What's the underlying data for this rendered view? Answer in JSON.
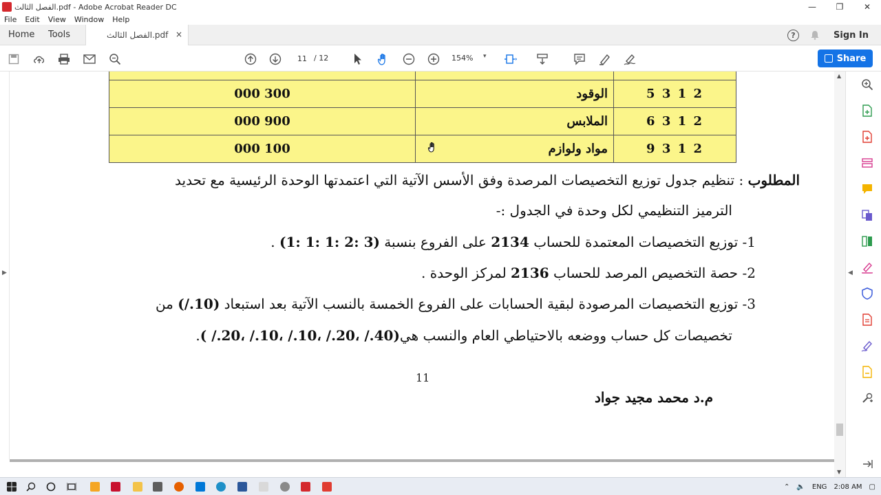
{
  "window": {
    "title": "الفصل الثالث.pdf - Adobe Acrobat Reader DC",
    "minimize": "—",
    "maximize": "❐",
    "close": "✕"
  },
  "menu": [
    "File",
    "Edit",
    "View",
    "Window",
    "Help"
  ],
  "tabs": {
    "home": "Home",
    "tools": "Tools",
    "document": "الفصل الثالث.pdf",
    "close": "×"
  },
  "header_right": {
    "help": "?",
    "sign_in": "Sign In"
  },
  "toolbar": {
    "current_page": "11",
    "total_pages": "/ 12",
    "zoom": "154%",
    "share": "Share"
  },
  "document": {
    "table_rows": [
      {
        "code": "2 1 3 5",
        "name": "الوقود",
        "amount": "300 000"
      },
      {
        "code": "2 1 3 6",
        "name": "الملابس",
        "amount": "900 000"
      },
      {
        "code": "2 1 3 9",
        "name": "مواد ولوازم",
        "amount": "100 000"
      }
    ],
    "required_label": "المطلوب",
    "required_text": " : تنظيم جدول توزيع التخصيصات المرصدة  وفق الأسس الآتية التي اعتمدتها الوحدة الرئيسية مع تحديد",
    "required_text_2": "الترميز التنظيمي لكل وحدة في الجدول :-",
    "item1_a": "1- توزيع التخصيصات المعتمدة للحساب ",
    "item1_num": "2134",
    "item1_b": " على الفروع بنسبة ",
    "item1_ratio": "(3 :2 :1 :1 :1)",
    "item1_c": " .",
    "item2_a": "2- حصة التخصيص المرصد للحساب ",
    "item2_num": "2136",
    "item2_b": " لمركز الوحدة .",
    "item3_a": "3- توزيع التخصيصات المرصودة لبقية الحسابات على الفروع الخمسة بالنسب الآتية بعد استبعاد ",
    "item3_pct": "(10./)",
    "item3_b": " من",
    "item3_line2_a": "تخصيصات كل حساب ووضعه بالاحتياطي العام والنسب هي",
    "item3_line2_pct": "(40./ ،20./ ،10./ ،10./ ،20./ )",
    "item3_line2_b": ".",
    "page_number": "11",
    "author": "م.د محمد مجيد جواد"
  },
  "taskbar": {
    "lang": "ENG",
    "time": "2:08 AM"
  },
  "colors": {
    "accent": "#1473e6",
    "table_fill": "#fbf58a"
  }
}
